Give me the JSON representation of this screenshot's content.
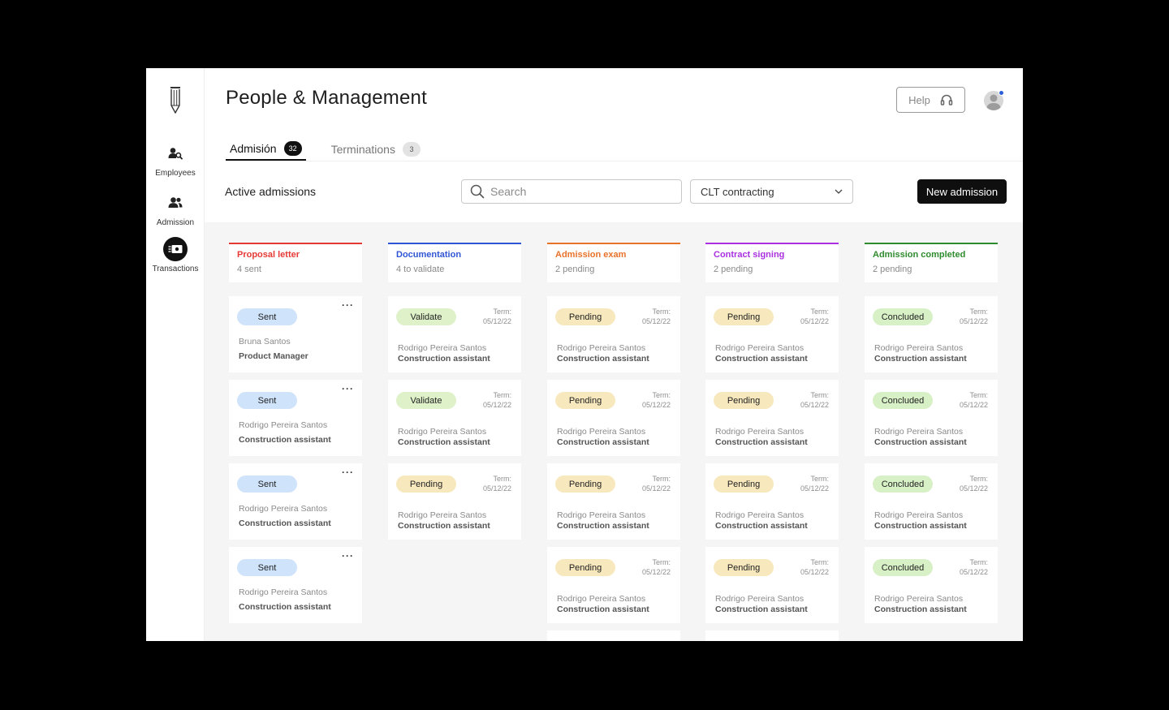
{
  "app": {
    "title": "People & Management"
  },
  "sidebar": {
    "items": [
      {
        "label": "Employees",
        "icon": "user-search-icon",
        "active": false
      },
      {
        "label": "Admission",
        "icon": "users-icon",
        "active": false
      },
      {
        "label": "Transactions",
        "icon": "money-icon",
        "active": true
      }
    ]
  },
  "header": {
    "help_label": "Help",
    "tabs": [
      {
        "label": "Admisión",
        "count": "32",
        "active": true
      },
      {
        "label": "Terminations",
        "count": "3",
        "active": false
      }
    ],
    "section_title": "Active admissions",
    "search_placeholder": "Search",
    "filter_value": "CLT contracting",
    "new_button": "New admission"
  },
  "colors": {
    "accent": "#0f0f0f",
    "notification": "#2b5fd9"
  },
  "board": {
    "term_label": "Term:",
    "columns": [
      {
        "title": "Proposal letter",
        "subtitle": "4 sent",
        "color": "#e53935",
        "cards": [
          {
            "status": "Sent",
            "kind": "sent",
            "name": "Bruna Santos",
            "role": "Product Manager",
            "menu": "···"
          },
          {
            "status": "Sent",
            "kind": "sent",
            "name": "Rodrigo Pereira Santos",
            "role": "Construction assistant",
            "menu": "···"
          },
          {
            "status": "Sent",
            "kind": "sent",
            "name": "Rodrigo Pereira Santos",
            "role": "Construction assistant",
            "menu": "···"
          },
          {
            "status": "Sent",
            "kind": "sent",
            "name": "Rodrigo Pereira Santos",
            "role": "Construction assistant",
            "menu": "···"
          }
        ]
      },
      {
        "title": "Documentation",
        "subtitle": "4 to validate",
        "color": "#2f55d4",
        "cards": [
          {
            "status": "Validate",
            "kind": "validate",
            "date": "05/12/22",
            "name": "Rodrigo Pereira Santos",
            "role": "Construction assistant"
          },
          {
            "status": "Validate",
            "kind": "validate",
            "date": "05/12/22",
            "name": "Rodrigo Pereira Santos",
            "role": "Construction assistant"
          },
          {
            "status": "Pending",
            "kind": "pending",
            "date": "05/12/22",
            "name": "Rodrigo Pereira Santos",
            "role": "Construction assistant"
          }
        ]
      },
      {
        "title": "Admission exam",
        "subtitle": "2 pending",
        "color": "#e8722a",
        "cards": [
          {
            "status": "Pending",
            "kind": "pending",
            "date": "05/12/22",
            "name": "Rodrigo Pereira Santos",
            "role": "Construction assistant"
          },
          {
            "status": "Pending",
            "kind": "pending",
            "date": "05/12/22",
            "name": "Rodrigo Pereira Santos",
            "role": "Construction assistant"
          },
          {
            "status": "Pending",
            "kind": "pending",
            "date": "05/12/22",
            "name": "Rodrigo Pereira Santos",
            "role": "Construction assistant"
          },
          {
            "status": "Pending",
            "kind": "pending",
            "date": "05/12/22",
            "name": "Rodrigo Pereira Santos",
            "role": "Construction assistant"
          }
        ],
        "more_below": true
      },
      {
        "title": "Contract signing",
        "subtitle": "2 pending",
        "color": "#a92fe0",
        "cards": [
          {
            "status": "Pending",
            "kind": "pending",
            "date": "05/12/22",
            "name": "Rodrigo Pereira Santos",
            "role": "Construction assistant"
          },
          {
            "status": "Pending",
            "kind": "pending",
            "date": "05/12/22",
            "name": "Rodrigo Pereira Santos",
            "role": "Construction assistant"
          },
          {
            "status": "Pending",
            "kind": "pending",
            "date": "05/12/22",
            "name": "Rodrigo Pereira Santos",
            "role": "Construction assistant"
          },
          {
            "status": "Pending",
            "kind": "pending",
            "date": "05/12/22",
            "name": "Rodrigo Pereira Santos",
            "role": "Construction assistant"
          }
        ],
        "more_below": true
      },
      {
        "title": "Admission completed",
        "subtitle": "2 pending",
        "color": "#2e8b2e",
        "cards": [
          {
            "status": "Concluded",
            "kind": "concluded",
            "date": "05/12/22",
            "name": "Rodrigo Pereira Santos",
            "role": "Construction assistant"
          },
          {
            "status": "Concluded",
            "kind": "concluded",
            "date": "05/12/22",
            "name": "Rodrigo Pereira Santos",
            "role": "Construction assistant"
          },
          {
            "status": "Concluded",
            "kind": "concluded",
            "date": "05/12/22",
            "name": "Rodrigo Pereira Santos",
            "role": "Construction assistant"
          },
          {
            "status": "Concluded",
            "kind": "concluded",
            "date": "05/12/22",
            "name": "Rodrigo Pereira Santos",
            "role": "Construction assistant"
          }
        ]
      }
    ]
  }
}
